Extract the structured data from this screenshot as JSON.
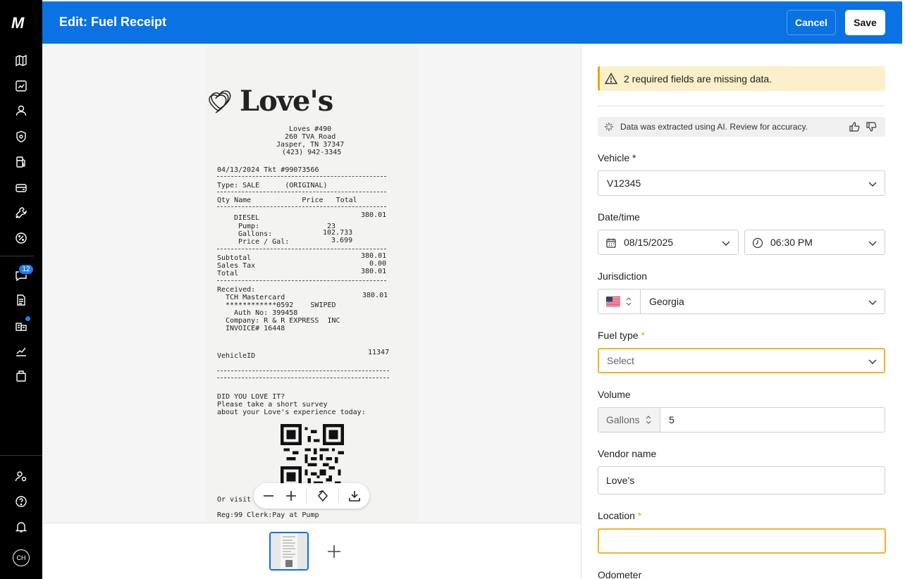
{
  "app": {
    "logo": "M"
  },
  "sidebar": {
    "badge_count": "12",
    "avatar_initials": "CH"
  },
  "header": {
    "title": "Edit: Fuel Receipt",
    "cancel_label": "Cancel",
    "save_label": "Save"
  },
  "receipt": {
    "brand": "Love's",
    "lines": [
      "Loves #490",
      "260 TVA Road",
      "Jasper, TN 37347",
      "(423) 942-3345",
      "04/13/2024 Tkt #99073566",
      "Type: SALE      (ORIGINAL)",
      "Qty Name            Price   Total",
      "DIESEL",
      "380.01",
      "Pump:",
      "23",
      "Gallons:",
      "102.733",
      "Price / Gal:",
      "3.699",
      "Subtotal",
      "380.01",
      "Sales Tax",
      "0.00",
      "Total",
      "380.01",
      "Received:",
      "380.01",
      "TCH Mastercard",
      "************0592    SWIPED",
      "Auth No: 399458",
      "Company: R & R EXPRESS  INC",
      "INVOICE# 16448",
      "VehicleID",
      "11347",
      "DID YOU LOVE IT?",
      "Please take a short survey",
      "about your Love's experience today:",
      "Or visit",
      "Reg:99 Clerk:Pay at Pump"
    ]
  },
  "form": {
    "warning": "2 required fields are missing data.",
    "ai_notice": "Data was extracted using AI. Review for accuracy.",
    "vehicle": {
      "label": "Vehicle *",
      "value": "V12345"
    },
    "datetime": {
      "label": "Date/time",
      "date": "08/15/2025",
      "time": "06:30 PM"
    },
    "jurisdiction": {
      "label": "Jurisdiction",
      "value": "Georgia"
    },
    "fuel_type": {
      "label": "Fuel type",
      "required": "*",
      "placeholder": "Select"
    },
    "volume": {
      "label": "Volume",
      "unit": "Gallons",
      "value": "5"
    },
    "vendor": {
      "label": "Vendor name",
      "value": "Love’s"
    },
    "location": {
      "label": "Location",
      "required": "*",
      "value": ""
    },
    "odometer": {
      "label": "Odometer"
    }
  },
  "colors": {
    "accent": "#0a72e3",
    "warning": "#e8a800",
    "sidebar": "#000000"
  }
}
